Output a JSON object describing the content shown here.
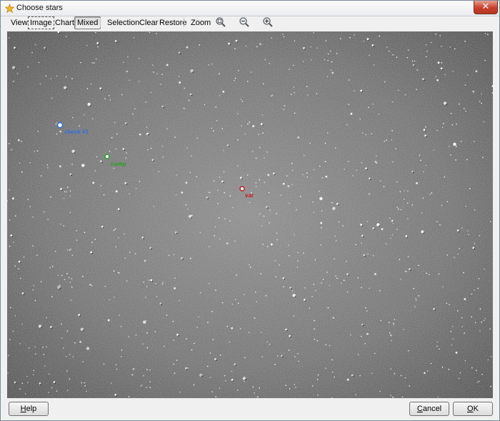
{
  "window": {
    "title": "Choose stars",
    "close_label": "✕"
  },
  "toolbar": {
    "view_label": "View",
    "image_label": "Image",
    "chart_label": "Chart",
    "mixed_label": "Mixed",
    "selection_label": "Selection",
    "clear_label": "Clear",
    "restore_label": "Restore",
    "zoom_label": "Zoom",
    "zoom_fit_icon": "magnifier-fit-icon",
    "zoom_out_icon": "magnifier-minus-icon",
    "zoom_in_icon": "magnifier-plus-icon"
  },
  "stars": {
    "comparison_label": "check #1",
    "check_label": "comp",
    "variable_label": "var",
    "comparison_color": "#2f6fe0",
    "check_color": "#1fa31f",
    "variable_color": "#d01818"
  },
  "footer": {
    "help_mnemonic": "H",
    "help_rest": "elp",
    "cancel_mnemonic": "C",
    "cancel_rest": "ancel",
    "ok_mnemonic": "O",
    "ok_rest": "K"
  }
}
